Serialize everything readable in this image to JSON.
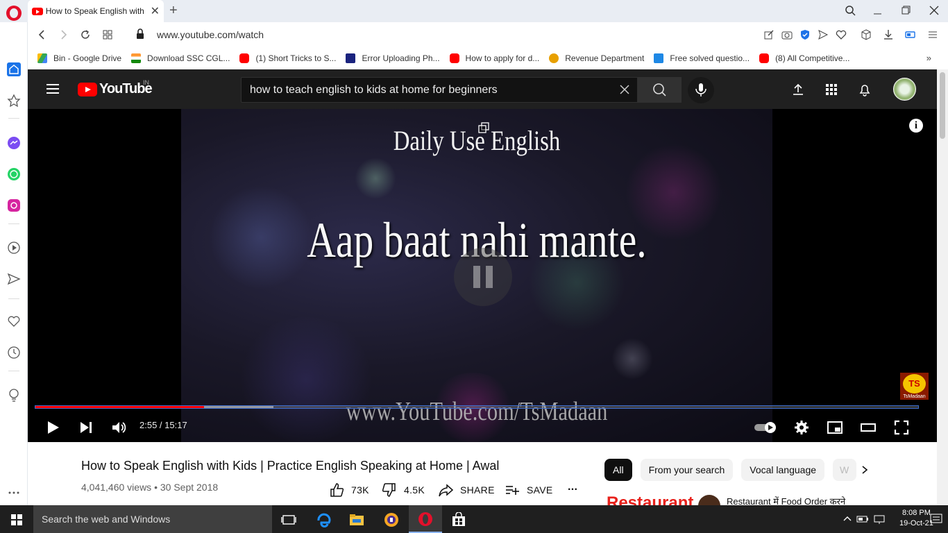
{
  "browser": {
    "tab": {
      "title": "How to Speak English with Kids | Practice English Speaking at Home | Awal"
    },
    "url": "www.youtube.com/watch",
    "bookmarks": [
      {
        "label": "Bin - Google Drive",
        "icon": "google-drive-icon",
        "color": "#34a853"
      },
      {
        "label": "Download SSC CGL...",
        "icon": "india-flag-icon",
        "color": "#ff9933"
      },
      {
        "label": "(1) Short Tricks to S...",
        "icon": "youtube-icon",
        "color": "#ff0000"
      },
      {
        "label": "Error Uploading Ph...",
        "icon": "site-icon",
        "color": "#1a237e"
      },
      {
        "label": "How to apply for d...",
        "icon": "youtube-icon",
        "color": "#ff0000"
      },
      {
        "label": "Revenue Department",
        "icon": "emblem-icon",
        "color": "#e8a000"
      },
      {
        "label": "Free solved questio...",
        "icon": "site-icon",
        "color": "#1e88e5"
      },
      {
        "label": "(8) All Competitive...",
        "icon": "youtube-icon",
        "color": "#ff0000"
      }
    ],
    "bookmarks_more": "»"
  },
  "youtube": {
    "logo_text": "YouTube",
    "country": "IN",
    "search_value": "how to teach english to kids at home for beginners"
  },
  "player": {
    "video_title_overlay": "Daily Use English",
    "caption": "Aap baat nahi mante.",
    "watermark_url": "www.YouTube.com/TsMadaan",
    "badge_text": "TS",
    "badge_label": "TsMadaan",
    "info": "i",
    "time": "2:55 / 15:17",
    "played_fraction": 0.191,
    "buffered_fraction": 0.27,
    "accent": "#ff0000"
  },
  "video": {
    "title": "How to Speak English with Kids | Practice English Speaking at Home | Awal",
    "meta": "4,041,460 views • 30 Sept 2018",
    "likes": "73K",
    "dislikes": "4.5K",
    "share": "SHARE",
    "save": "SAVE",
    "more": "..."
  },
  "chips": [
    {
      "label": "All",
      "active": true
    },
    {
      "label": "From your search",
      "active": false
    },
    {
      "label": "Vocal language",
      "active": false
    },
    {
      "label": "W",
      "active": false
    }
  ],
  "recommendation": {
    "thumb_text": "Restaurant",
    "title": "Restaurant में Food Order करने"
  },
  "taskbar": {
    "search_placeholder": "Search the web and Windows",
    "time": "8:08 PM",
    "date": "19-Oct-21"
  }
}
